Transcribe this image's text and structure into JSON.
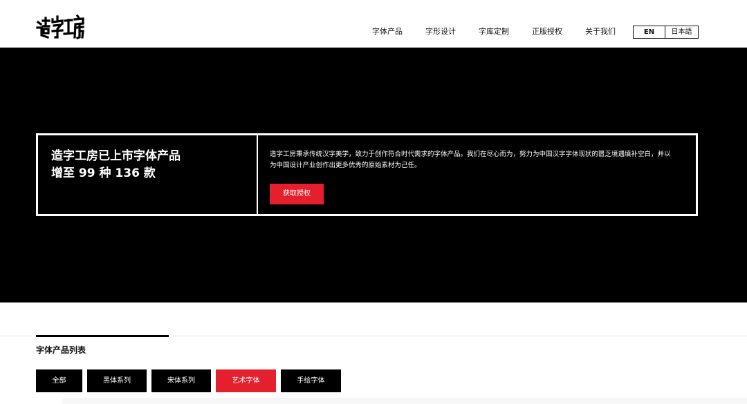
{
  "header": {
    "logo_text": "造字工房",
    "nav": [
      "字体产品",
      "字形设计",
      "字库定制",
      "正版授权",
      "关于我们"
    ],
    "lang": {
      "en": "EN",
      "jp": "日本語"
    }
  },
  "hero": {
    "title_line1": "造字工房已上市字体产品",
    "title_line2": "增至 99 种 136 款",
    "description": "造字工房秉承传统汉字美学，致力于创作符合时代需求的字体产品。我们在尽心而为，努力为中国汉字字体现状的匮乏境遇填补空白，并以为中国设计产业创作出更多优秀的原始素材为己任。",
    "cta_label": "获取授权"
  },
  "products": {
    "section_title": "字体产品列表",
    "tabs": [
      "全部",
      "黑体系列",
      "宋体系列",
      "艺术字体",
      "手绘字体"
    ],
    "active_tab": "艺术字体"
  },
  "colors": {
    "accent": "#e5202e",
    "hero_bg": "#000000"
  },
  "icons": [
    "logo-icon"
  ]
}
